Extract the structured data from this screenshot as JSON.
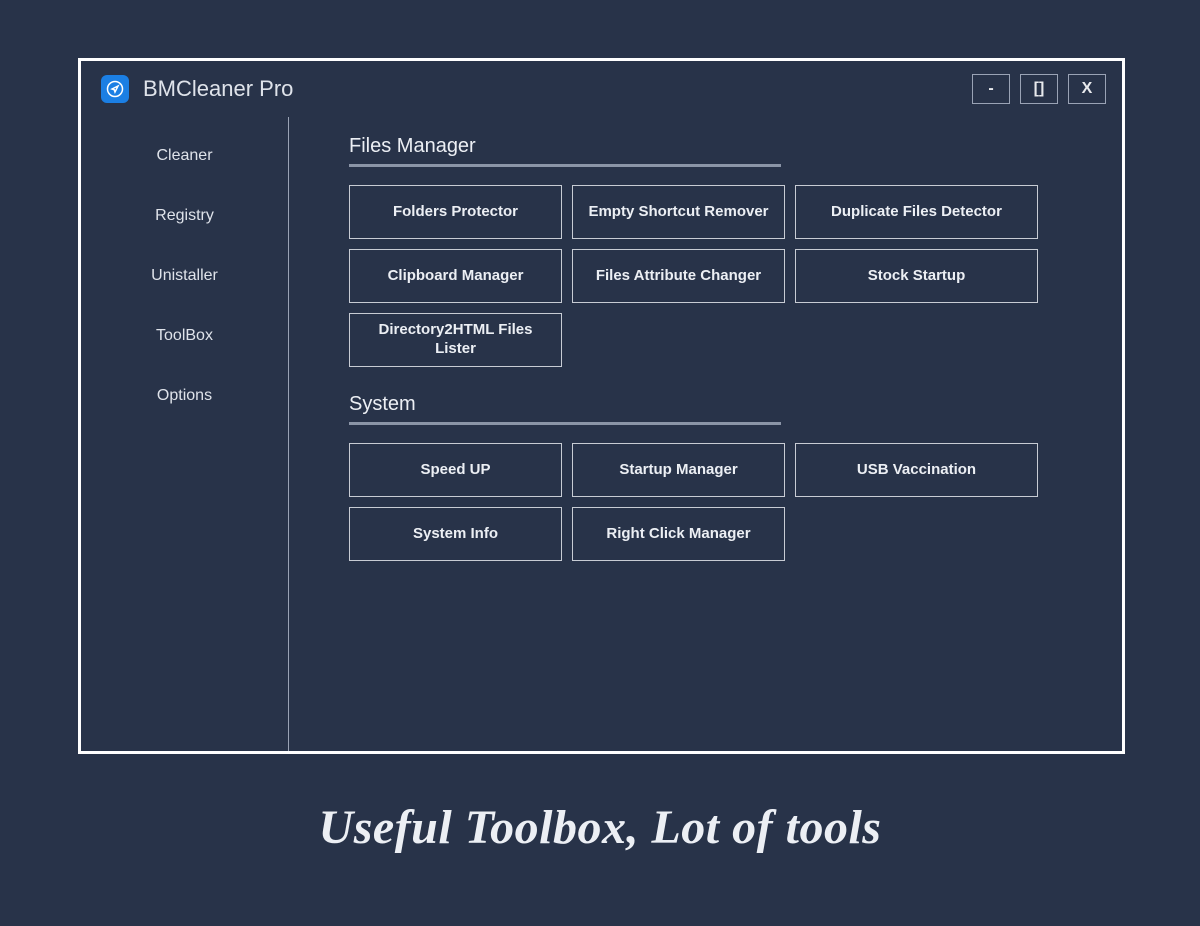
{
  "app": {
    "title": "BMCleaner Pro",
    "icon_name": "paper-plane-icon",
    "window_controls": {
      "minimize": "-",
      "maximize": "[]",
      "close": "X"
    }
  },
  "sidebar": {
    "items": [
      {
        "label": "Cleaner"
      },
      {
        "label": "Registry"
      },
      {
        "label": "Unistaller"
      },
      {
        "label": "ToolBox"
      },
      {
        "label": "Options"
      }
    ]
  },
  "main": {
    "sections": [
      {
        "title": "Files Manager",
        "tools": [
          "Folders Protector",
          "Empty Shortcut Remover",
          "Duplicate Files Detector",
          "Clipboard Manager",
          "Files Attribute Changer",
          "Stock Startup",
          "Directory2HTML Files Lister"
        ]
      },
      {
        "title": "System",
        "tools": [
          "Speed UP",
          "Startup Manager",
          "USB Vaccination",
          "System Info",
          "Right Click Manager"
        ]
      }
    ]
  },
  "tagline": "Useful Toolbox, Lot of tools"
}
